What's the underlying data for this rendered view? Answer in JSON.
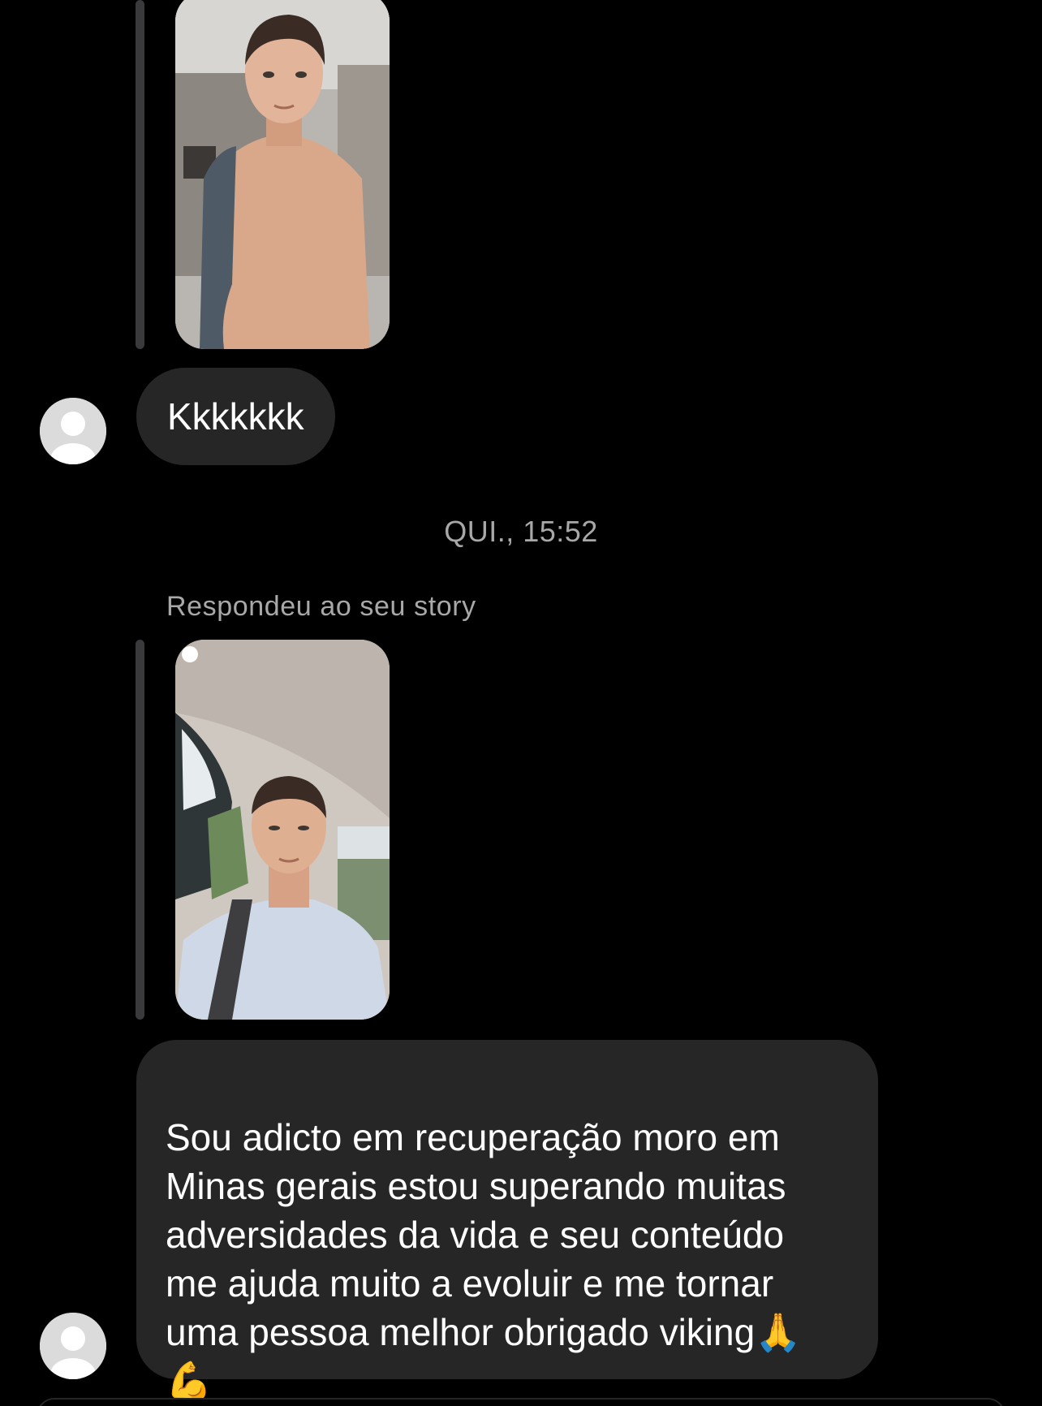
{
  "conversation": {
    "messages": [
      {
        "type": "story_reply_image",
        "avatar_icon": "default-user-avatar-icon"
      },
      {
        "type": "text",
        "text": "Kkkkkkk"
      },
      {
        "type": "timestamp",
        "text": "QUI., 15:52"
      },
      {
        "type": "story_reply_label",
        "text": "Respondeu ao seu story"
      },
      {
        "type": "story_reply_image"
      },
      {
        "type": "text",
        "text": "Sou adicto em recuperação moro em\nMinas gerais estou superando muitas\nadversidades da vida e seu conteúdo\nme ajuda muito a evoluir e me tornar\numa pessoa melhor obrigado viking🙏\n💪"
      }
    ]
  },
  "colors": {
    "background": "#000000",
    "bubble": "#262626",
    "secondary_text": "#a8a8a8",
    "reply_bar": "#3a3a3c"
  }
}
